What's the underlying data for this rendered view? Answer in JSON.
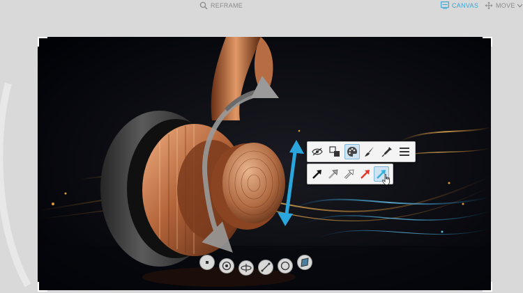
{
  "topbar": {
    "reframe_label": "REFRAME",
    "canvas_label": "CANVAS",
    "move_label": "MOVE"
  },
  "canvas": {
    "subject": "headphone-render"
  },
  "arrow_toolbar": {
    "style_tools": [
      {
        "name": "hide-tool",
        "icon": "eye-slash-icon"
      },
      {
        "name": "layer-tool",
        "icon": "layers-icon"
      },
      {
        "name": "color-palette-tool",
        "icon": "palette-icon",
        "selected": true
      },
      {
        "name": "brush-tool",
        "icon": "brush-icon"
      },
      {
        "name": "eyedropper-tool",
        "icon": "eyedropper-icon"
      },
      {
        "name": "menu-tool",
        "icon": "menu-icon"
      }
    ],
    "arrow_colors": [
      "#111111",
      "#a6a6a6",
      "#ffffff",
      "#e2382b",
      "#35b0dc"
    ],
    "selected_color": "#35b0dc"
  },
  "bottom_tools": [
    {
      "name": "point-tool",
      "icon": "dot-icon"
    },
    {
      "name": "target-tool",
      "icon": "target-icon"
    },
    {
      "name": "rotate-tool",
      "icon": "orbit-icon"
    },
    {
      "name": "line-tool",
      "icon": "line-icon"
    },
    {
      "name": "circle-tool",
      "icon": "circle-icon"
    },
    {
      "name": "plane-tool",
      "icon": "plane-icon"
    }
  ],
  "colors": {
    "accent": "#3aa6d6",
    "annotation_blue": "#2ba6dc",
    "annotation_gray": "#8f8f8f"
  }
}
